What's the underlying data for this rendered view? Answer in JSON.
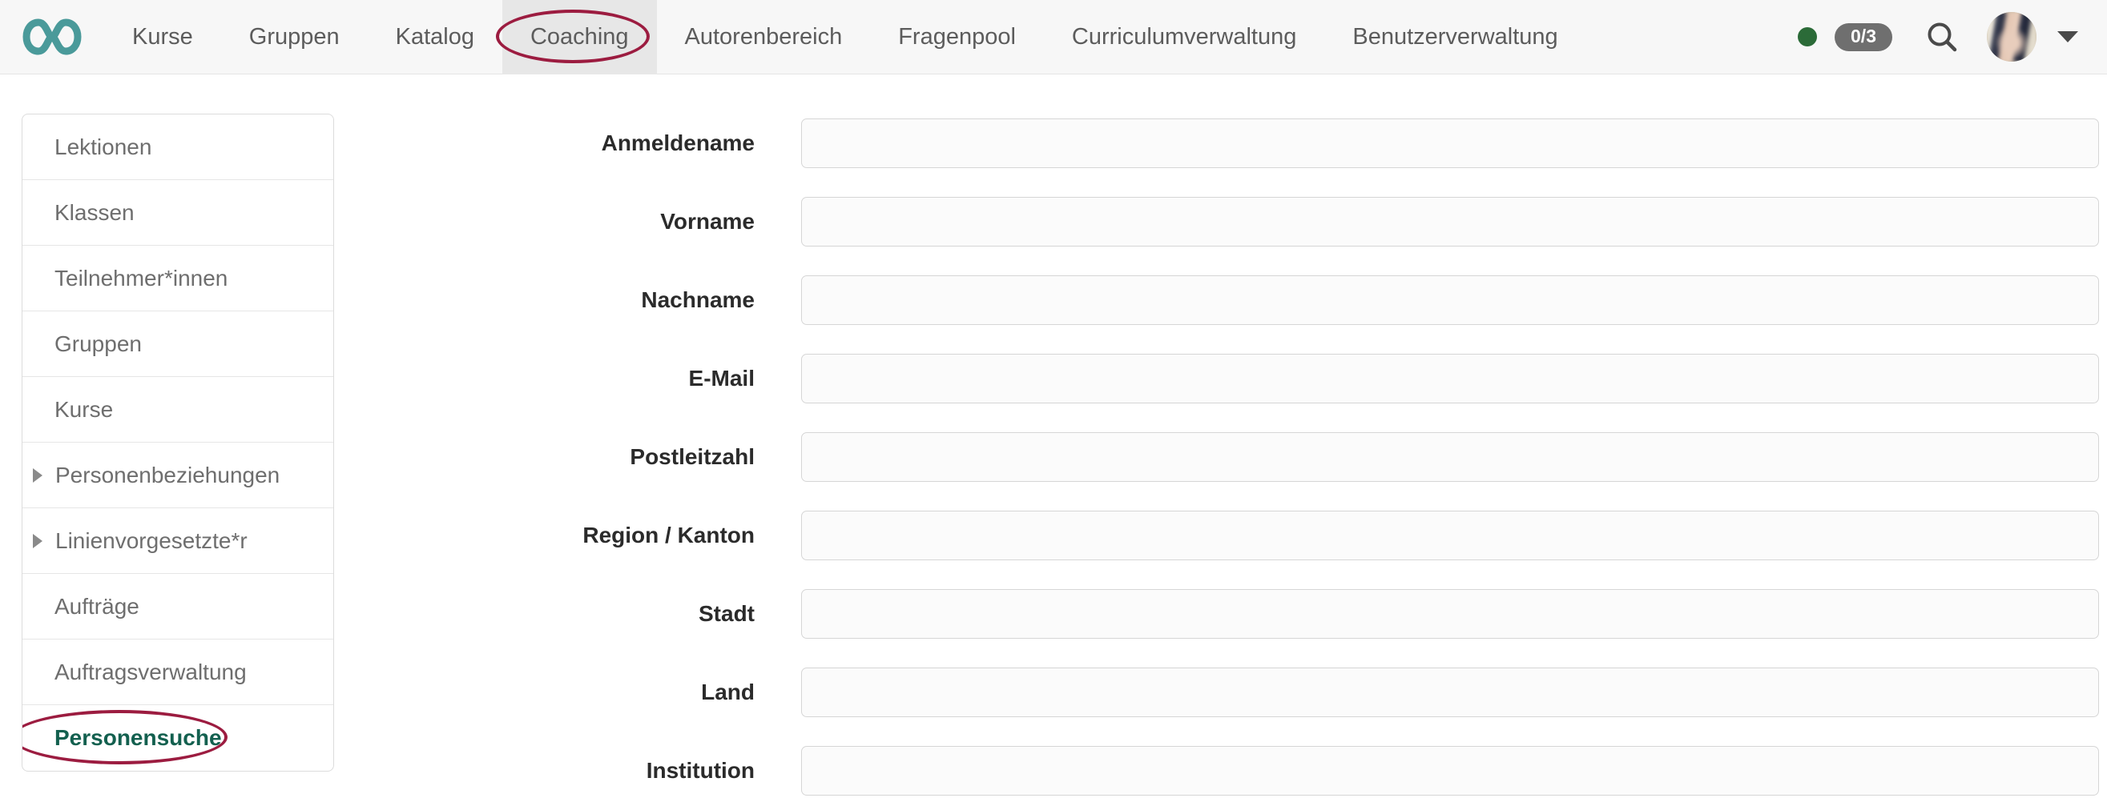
{
  "header": {
    "logo_icon": "infinity-logo-icon",
    "logo_color": "#4a9a9a",
    "nav": [
      {
        "label": "Kurse",
        "active": false
      },
      {
        "label": "Gruppen",
        "active": false
      },
      {
        "label": "Katalog",
        "active": false
      },
      {
        "label": "Coaching",
        "active": true
      },
      {
        "label": "Autorenbereich",
        "active": false
      },
      {
        "label": "Fragenpool",
        "active": false
      },
      {
        "label": "Curriculumverwaltung",
        "active": false
      },
      {
        "label": "Benutzerverwaltung",
        "active": false
      }
    ],
    "status_dot_color": "#2b6b38",
    "count_badge": "0/3",
    "count_badge_color": "#6f6f6f",
    "search_icon": "search-icon",
    "avatar_icon": "user-avatar",
    "caret_icon": "chevron-down-icon",
    "annotation_color": "#9c1c40"
  },
  "sidebar": {
    "items": [
      {
        "label": "Lektionen",
        "expandable": false,
        "active": false
      },
      {
        "label": "Klassen",
        "expandable": false,
        "active": false
      },
      {
        "label": "Teilnehmer*innen",
        "expandable": false,
        "active": false
      },
      {
        "label": "Gruppen",
        "expandable": false,
        "active": false
      },
      {
        "label": "Kurse",
        "expandable": false,
        "active": false
      },
      {
        "label": "Personenbeziehungen",
        "expandable": true,
        "active": false
      },
      {
        "label": "Linienvorgesetzte*r",
        "expandable": true,
        "active": false
      },
      {
        "label": "Aufträge",
        "expandable": false,
        "active": false
      },
      {
        "label": "Auftragsverwaltung",
        "expandable": false,
        "active": false
      },
      {
        "label": "Personensuche",
        "expandable": false,
        "active": true
      }
    ],
    "active_color": "#13604f",
    "annotation_color": "#9c1c40"
  },
  "form": {
    "fields": [
      {
        "label": "Anmeldename",
        "value": "",
        "placeholder": ""
      },
      {
        "label": "Vorname",
        "value": "",
        "placeholder": ""
      },
      {
        "label": "Nachname",
        "value": "",
        "placeholder": ""
      },
      {
        "label": "E-Mail",
        "value": "",
        "placeholder": ""
      },
      {
        "label": "Postleitzahl",
        "value": "",
        "placeholder": ""
      },
      {
        "label": "Region / Kanton",
        "value": "",
        "placeholder": ""
      },
      {
        "label": "Stadt",
        "value": "",
        "placeholder": ""
      },
      {
        "label": "Land",
        "value": "",
        "placeholder": ""
      },
      {
        "label": "Institution",
        "value": "",
        "placeholder": ""
      }
    ]
  }
}
